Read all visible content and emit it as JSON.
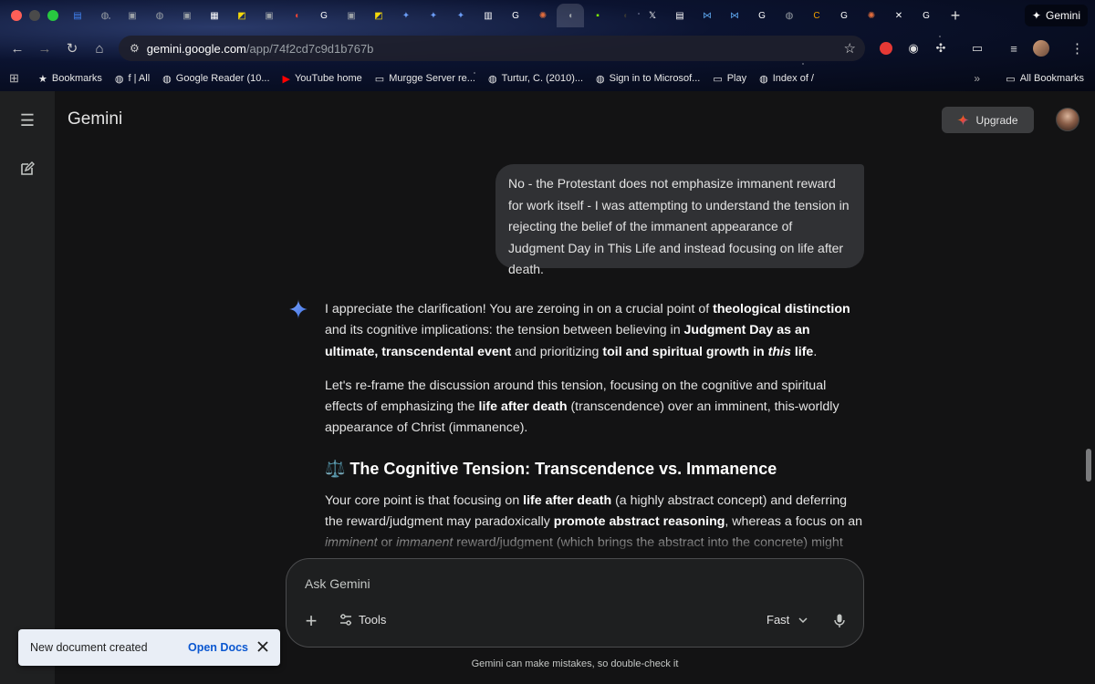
{
  "browser": {
    "tabs": [
      {
        "icon": "docs-icon",
        "color": "#4285f4"
      },
      {
        "icon": "globe-icon",
        "color": "#9aa0a6"
      },
      {
        "icon": "site-icon",
        "color": "#9aa0a6"
      },
      {
        "icon": "globe-icon",
        "color": "#9aa0a6"
      },
      {
        "icon": "site-icon",
        "color": "#9aa0a6"
      },
      {
        "icon": "grid-icon",
        "color": "#ffffff"
      },
      {
        "icon": "yellow-app-icon",
        "color": "#f5d90a"
      },
      {
        "icon": "site-icon",
        "color": "#9aa0a6"
      },
      {
        "icon": "dark-icon",
        "color": "#ea4335"
      },
      {
        "icon": "google-icon",
        "color": "#ffffff"
      },
      {
        "icon": "site-icon",
        "color": "#9aa0a6"
      },
      {
        "icon": "yellow-app-icon",
        "color": "#f5d90a"
      },
      {
        "icon": "gemini-icon",
        "color": "#6a9bf4"
      },
      {
        "icon": "gemini-icon",
        "color": "#6a9bf4"
      },
      {
        "icon": "gemini-icon",
        "color": "#6a9bf4"
      },
      {
        "icon": "news-icon",
        "color": "#ffffff"
      },
      {
        "icon": "google-icon",
        "color": "#ffffff"
      },
      {
        "icon": "claude-icon",
        "color": "#e06c3c"
      },
      {
        "icon": "audio-icon",
        "color": "#9aa0a6"
      },
      {
        "icon": "app-icon",
        "color": "#7cfc00"
      },
      {
        "icon": "dark-icon",
        "color": "#333333"
      },
      {
        "icon": "x-icon",
        "color": "#ffffff"
      },
      {
        "icon": "docs-icon",
        "color": "#ffffff"
      },
      {
        "icon": "media-icon",
        "color": "#5aa0e6"
      },
      {
        "icon": "media-icon",
        "color": "#5aa0e6"
      },
      {
        "icon": "google-icon",
        "color": "#ffffff"
      },
      {
        "icon": "globe-icon",
        "color": "#9aa0a6"
      },
      {
        "icon": "c-icon",
        "color": "#f0a000"
      },
      {
        "icon": "google-icon",
        "color": "#ffffff"
      },
      {
        "icon": "claude-icon",
        "color": "#e06c3c"
      },
      {
        "icon": "close-icon",
        "color": "#ffffff"
      },
      {
        "icon": "google-icon",
        "color": "#ffffff"
      }
    ],
    "active_tab_label": "Gemini",
    "url_host": "gemini.google.com",
    "url_path": "/app/74f2cd7c9d1b767b",
    "bookmarks": [
      {
        "label": "Bookmarks",
        "icon": "star-icon"
      },
      {
        "label": "f | All",
        "icon": "globe-icon"
      },
      {
        "label": "Google Reader (10...",
        "icon": "globe-icon"
      },
      {
        "label": "YouTube home",
        "icon": "youtube-icon"
      },
      {
        "label": "Murgge Server re...",
        "icon": "folder-icon"
      },
      {
        "label": "Turtur, C. (2010)...",
        "icon": "globe-icon"
      },
      {
        "label": "Sign in to Microsof...",
        "icon": "globe-icon"
      },
      {
        "label": "Play",
        "icon": "folder-icon"
      },
      {
        "label": "Index of /",
        "icon": "globe-icon"
      }
    ],
    "all_bookmarks_label": "All Bookmarks"
  },
  "app": {
    "brand": "Gemini",
    "upgrade_label": "Upgrade",
    "user_message": "No - the Protestant does not emphasize immanent reward for work itself - I was attempting to understand the tension in rejecting the belief of the immanent appearance of Judgment Day in This Life and instead focusing on life after death.",
    "response": {
      "p1": [
        {
          "t": "I appreciate the clarification! You are zeroing in on a crucial point of "
        },
        {
          "t": "theological distinction",
          "b": true
        },
        {
          "t": " and its cognitive implications: the tension between believing in "
        },
        {
          "t": "Judgment Day as an ultimate, transcendental event",
          "b": true
        },
        {
          "t": " and prioritizing "
        },
        {
          "t": "toil and spiritual growth in ",
          "b": true
        },
        {
          "t": "this",
          "b": true,
          "i": true
        },
        {
          "t": " life",
          "b": true
        },
        {
          "t": "."
        }
      ],
      "p2": [
        {
          "t": "Let's re-frame the discussion around this tension, focusing on the cognitive and spiritual effects of emphasizing the "
        },
        {
          "t": "life after death",
          "b": true
        },
        {
          "t": " (transcendence) over an imminent, this-worldly appearance of Christ (immanence)."
        }
      ],
      "heading": "⚖️ The Cognitive Tension: Transcendence vs. Immanence",
      "p3": [
        {
          "t": "Your core point is that focusing on "
        },
        {
          "t": "life after death",
          "b": true
        },
        {
          "t": " (a highly abstract concept) and deferring the reward/judgment may paradoxically "
        },
        {
          "t": "promote abstract reasoning",
          "b": true
        },
        {
          "t": ", whereas a focus on an "
        },
        {
          "t": "imminent",
          "i": true
        },
        {
          "t": " or "
        },
        {
          "t": "immanent",
          "i": true
        },
        {
          "t": " reward/judgment (which brings the abstract into the concrete) might"
        }
      ]
    },
    "composer": {
      "placeholder": "Ask Gemini",
      "tools_label": "Tools",
      "mode_label": "Fast"
    },
    "disclaimer": "Gemini can make mistakes, so double-check it",
    "toast": {
      "message": "New document created",
      "action": "Open Docs"
    }
  }
}
